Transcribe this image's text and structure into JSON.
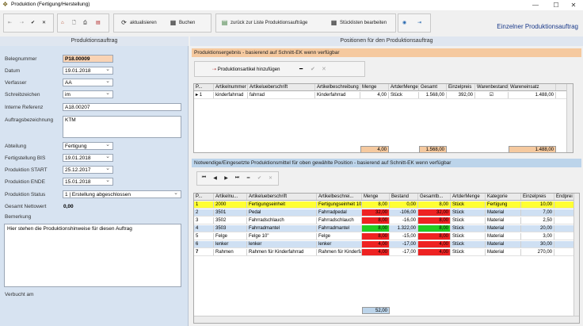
{
  "window": {
    "title": "Produktion (Fertigung/Herstellung)",
    "header_title": "Einzelner Produktionsauftrag"
  },
  "toolbar": {
    "refresh": "aktualisieren",
    "save": "Buchen",
    "back": "zurück zur Liste Produktionsaufträge",
    "bom": "Stücklisten bearbeiten"
  },
  "left": {
    "title": "Produktionsauftrag",
    "fields": {
      "belegnummer": {
        "label": "Belegnummer",
        "value": "P18.00009"
      },
      "datum": {
        "label": "Datum",
        "value": "19.01.2018"
      },
      "verfasser": {
        "label": "Verfasser",
        "value": "AA"
      },
      "schreibzeichen": {
        "label": "Schreibzeichen",
        "value": "im"
      },
      "interne_referenz": {
        "label": "Interne Referenz",
        "value": "A18.00207"
      },
      "auftragsbezeichnung": {
        "label": "Auftragsbezeichnung",
        "value": "KTM"
      },
      "abteilung": {
        "label": "Abteilung",
        "value": "Fertigung"
      },
      "fertigstellung": {
        "label": "Fertigstellung BIS",
        "value": "19.01.2018"
      },
      "start": {
        "label": "Produktion START",
        "value": "25.12.2017"
      },
      "ende": {
        "label": "Produktion ENDE",
        "value": "15.01.2018"
      },
      "status": {
        "label": "Produktion Status",
        "value": "1 | Erstellung abgeschlossen"
      },
      "netto": {
        "label": "Gesamt Nettowert",
        "value": "0,00"
      }
    },
    "bemerkung_label": "Bemerkung",
    "bemerkung": "Hier stehen die Produktionshinweise für diesen Auftrag",
    "verbucht_label": "Verbucht am"
  },
  "right": {
    "title": "Positionen für den Produktionsauftrag",
    "section1": "Produktionsergebnis - basierend auf Schnitt-EK wenn verfügbar",
    "add_button": "Produktionsartikel hinzufügen",
    "grid1": {
      "columns": [
        "P...",
        "Artikelnummer",
        "Artikelueberschrift",
        "Artikelbeschreibung",
        "Menge",
        "ArtderMenge",
        "Gesamt",
        "Einzelpreis",
        "Warenbestand",
        "Wareneinsatz"
      ],
      "rows": [
        [
          "1",
          "kinderfahrrad",
          "fahrrad",
          "Kinderfahrrad",
          "4,00",
          "Stück",
          "1.568,00",
          "392,00",
          "",
          "1.488,00"
        ]
      ],
      "totals": {
        "menge": "4,00",
        "gesamt": "1.568,00",
        "wareneinsatz": "1.488,00"
      }
    },
    "section2": "Notwendige/Eingesetzte Produktionsmittel für oben gewählte Position - basierend auf Schnitt-EK wenn verfügbar",
    "grid2": {
      "columns": [
        "P...",
        "Artikelnu...",
        "Artikelueberschrift",
        "Artikelbeschrei...",
        "Menge",
        "Bestand",
        "Gesamtb...",
        "ArtderMenge",
        "Kategorie",
        "Einzelpreis",
        "Endprei"
      ],
      "rows": [
        [
          "1",
          "2000",
          "Fertigungseinheit",
          "Fertigungseinheit 10 h",
          "8,00",
          "0,00",
          "8,00",
          "Stück",
          "Fertigung",
          "10,00"
        ],
        [
          "2",
          "3501",
          "Pedal",
          "Fahrradpedal",
          "32,00",
          "-106,00",
          "32,00",
          "Stück",
          "Material",
          "7,00"
        ],
        [
          "3",
          "3502",
          "Fahrradschlauch",
          "Fahrradschlauch",
          "8,00",
          "-16,00",
          "8,00",
          "Stück",
          "Material",
          "2,50"
        ],
        [
          "4",
          "3503",
          "Fahrradmantel",
          "Fahrradmantel",
          "8,00",
          "1.322,00",
          "8,00",
          "Stück",
          "Material",
          "20,00"
        ],
        [
          "5",
          "Felge",
          "Felge 10\"",
          "Felge",
          "8,00",
          "-15,00",
          "8,00",
          "Stück",
          "Material",
          "3,00"
        ],
        [
          "6",
          "lenker",
          "lenker",
          "lenker",
          "4,00",
          "-17,00",
          "4,00",
          "Stück",
          "Material",
          "30,00"
        ],
        [
          "7",
          "Rahmen",
          "Rahmen für Kinderfahrrad",
          "Rahmen für Kinderfahrrad",
          "4,00",
          "-17,00",
          "4,00",
          "Stück",
          "Material",
          "270,00"
        ]
      ],
      "totals": {
        "menge": "52,00"
      }
    }
  }
}
